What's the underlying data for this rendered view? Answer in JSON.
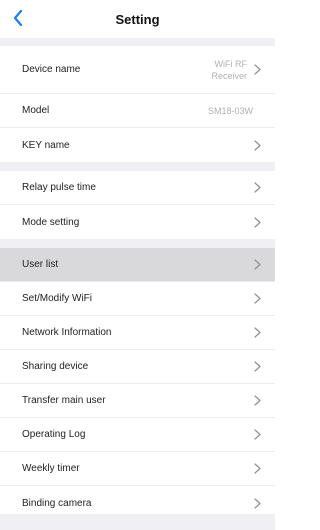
{
  "header": {
    "title": "Setting",
    "back_icon": "chevron-left-icon",
    "accent_color": "#1e7cf2"
  },
  "groups": [
    {
      "items": [
        {
          "name": "device-name",
          "label": "Device name",
          "value_lines": [
            "WiFi RF",
            "Receiver"
          ],
          "arrow": true
        },
        {
          "name": "model",
          "label": "Model",
          "value": "SM18-03W",
          "arrow": false
        },
        {
          "name": "key-name",
          "label": "KEY name",
          "arrow": true
        }
      ]
    },
    {
      "items": [
        {
          "name": "relay-pulse-time",
          "label": "Relay pulse time",
          "arrow": true
        },
        {
          "name": "mode-setting",
          "label": "Mode setting",
          "arrow": true
        }
      ]
    },
    {
      "items": [
        {
          "name": "user-list",
          "label": "User list",
          "arrow": true,
          "highlighted": true
        },
        {
          "name": "set-modify-wifi",
          "label": "Set/Modify WiFi",
          "arrow": true
        },
        {
          "name": "network-information",
          "label": "Network Information",
          "arrow": true
        },
        {
          "name": "sharing-device",
          "label": "Sharing device",
          "arrow": true
        },
        {
          "name": "transfer-main-user",
          "label": "Transfer main user",
          "arrow": true
        },
        {
          "name": "operating-log",
          "label": "Operating Log",
          "arrow": true
        },
        {
          "name": "weekly-timer",
          "label": "Weekly timer",
          "arrow": true
        },
        {
          "name": "binding-camera",
          "label": "Binding camera",
          "arrow": true
        }
      ]
    }
  ],
  "colors": {
    "background": "#ffffff",
    "group_gap": "#efeff4",
    "highlight_row": "#d9d9dc",
    "secondary_text": "#b0b0b0"
  }
}
